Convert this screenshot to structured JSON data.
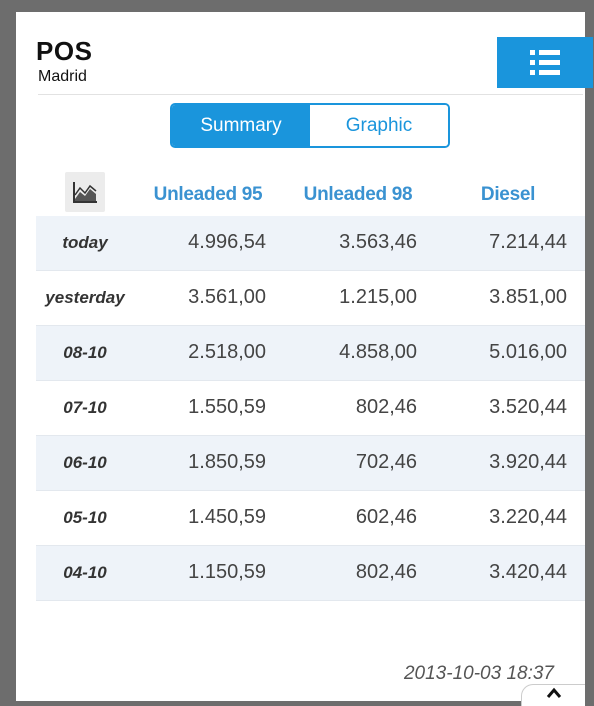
{
  "header": {
    "title": "POS",
    "subtitle": "Madrid",
    "menu_icon": "list-icon"
  },
  "tabs": [
    {
      "label": "Summary",
      "active": true
    },
    {
      "label": "Graphic",
      "active": false
    }
  ],
  "table": {
    "chart_icon": "area-chart-icon",
    "columns": [
      "Unleaded 95",
      "Unleaded 98",
      "Diesel"
    ],
    "rows": [
      {
        "label": "today",
        "values": [
          "4.996,54",
          "3.563,46",
          "7.214,44"
        ]
      },
      {
        "label": "yesterday",
        "values": [
          "3.561,00",
          "1.215,00",
          "3.851,00"
        ]
      },
      {
        "label": "08-10",
        "values": [
          "2.518,00",
          "4.858,00",
          "5.016,00"
        ]
      },
      {
        "label": "07-10",
        "values": [
          "1.550,59",
          "802,46",
          "3.520,44"
        ]
      },
      {
        "label": "06-10",
        "values": [
          "1.850,59",
          "702,46",
          "3.920,44"
        ]
      },
      {
        "label": "05-10",
        "values": [
          "1.450,59",
          "602,46",
          "3.220,44"
        ]
      },
      {
        "label": "04-10",
        "values": [
          "1.150,59",
          "802,46",
          "3.420,44"
        ]
      }
    ]
  },
  "footer": {
    "timestamp": "2013-10-03 18:37",
    "collapse_icon": "chevron-up-icon"
  },
  "colors": {
    "accent": "#1a95dc",
    "column_header": "#3a92d1",
    "row_shade": "#eef3f9",
    "frame": "#6d6d6d"
  }
}
